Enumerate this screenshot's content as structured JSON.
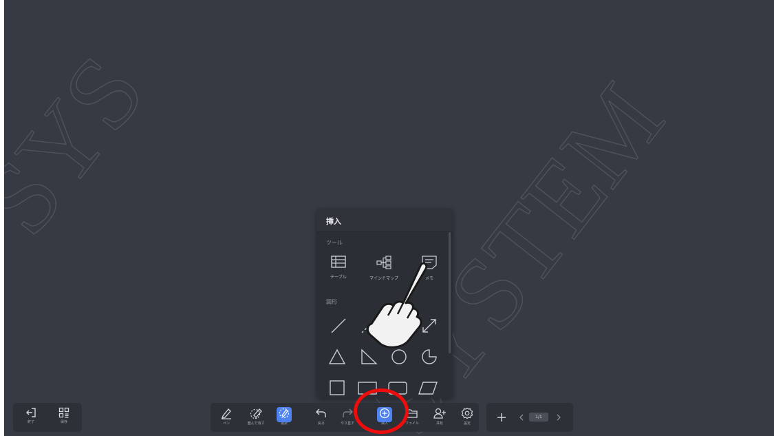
{
  "watermark": {
    "text_left": "SYS",
    "text_right": "SYSTEM"
  },
  "insert_panel": {
    "title": "挿入",
    "tools_section": "ツール",
    "tools": [
      {
        "label": "テーブル",
        "icon": "table-icon"
      },
      {
        "label": "マインドマップ",
        "icon": "mindmap-icon"
      },
      {
        "label": "メモ",
        "icon": "memo-icon"
      }
    ],
    "shapes_section": "図形",
    "shapes": [
      "line",
      "dashed-line",
      "double-arrow-line",
      "triangle",
      "right-triangle",
      "circle",
      "pie",
      "square",
      "rectangle",
      "rounded-rectangle",
      "parallelogram"
    ]
  },
  "left_toolbar": {
    "items": [
      {
        "label": "終了",
        "icon": "exit-icon"
      },
      {
        "label": "保存",
        "icon": "save-grid-icon"
      }
    ]
  },
  "main_toolbar": {
    "items": [
      {
        "label": "ペン",
        "icon": "pen-icon"
      },
      {
        "label": "囲んで消す",
        "icon": "lasso-eraser-icon"
      },
      {
        "label": "選択",
        "icon": "select-icon",
        "active": true
      },
      {
        "label": "戻る",
        "icon": "undo-icon"
      },
      {
        "label": "やり直す",
        "icon": "redo-icon"
      },
      {
        "label": "挿入",
        "icon": "insert-plus-icon",
        "active": true
      },
      {
        "label": "ファイル",
        "icon": "folder-icon"
      },
      {
        "label": "共有",
        "icon": "share-user-icon"
      },
      {
        "label": "設定",
        "icon": "settings-icon"
      }
    ]
  },
  "page_nav": {
    "page": "1/1",
    "add_icon": "plus-icon"
  },
  "colors": {
    "canvas": "#363a42",
    "accent": "#4d82f0",
    "highlight": "#ee0d0d"
  }
}
